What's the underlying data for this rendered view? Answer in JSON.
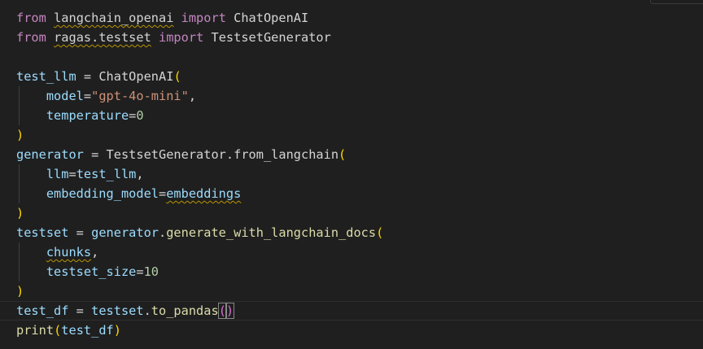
{
  "editor": {
    "lines": [
      [
        {
          "t": "from",
          "c": "kw"
        },
        {
          "t": " ",
          "c": "tx"
        },
        {
          "t": "langchain_openai",
          "c": "tx",
          "squig": true
        },
        {
          "t": " ",
          "c": "tx"
        },
        {
          "t": "import",
          "c": "kw"
        },
        {
          "t": " ChatOpenAI",
          "c": "tx"
        }
      ],
      [
        {
          "t": "from",
          "c": "kw"
        },
        {
          "t": " ",
          "c": "tx"
        },
        {
          "t": "ragas.testset",
          "c": "tx",
          "squig": true
        },
        {
          "t": " ",
          "c": "tx"
        },
        {
          "t": "import",
          "c": "kw"
        },
        {
          "t": " TestsetGenerator",
          "c": "tx"
        }
      ],
      [],
      [
        {
          "t": "test_llm",
          "c": "vr"
        },
        {
          "t": " = ",
          "c": "tx"
        },
        {
          "t": "ChatOpenAI",
          "c": "tx"
        },
        {
          "t": "(",
          "c": "p1"
        }
      ],
      [
        {
          "t": "    ",
          "c": "tx"
        },
        {
          "t": "model",
          "c": "vr"
        },
        {
          "t": "=",
          "c": "tx"
        },
        {
          "t": "\"gpt-4o-mini\"",
          "c": "st"
        },
        {
          "t": ",",
          "c": "tx"
        }
      ],
      [
        {
          "t": "    ",
          "c": "tx"
        },
        {
          "t": "temperature",
          "c": "vr"
        },
        {
          "t": "=",
          "c": "tx"
        },
        {
          "t": "0",
          "c": "nm"
        }
      ],
      [
        {
          "t": ")",
          "c": "p1"
        }
      ],
      [
        {
          "t": "generator",
          "c": "vr"
        },
        {
          "t": " = ",
          "c": "tx"
        },
        {
          "t": "TestsetGenerator",
          "c": "tx"
        },
        {
          "t": ".",
          "c": "tx"
        },
        {
          "t": "from_langchain",
          "c": "tx"
        },
        {
          "t": "(",
          "c": "p1"
        }
      ],
      [
        {
          "t": "    ",
          "c": "tx"
        },
        {
          "t": "llm",
          "c": "vr"
        },
        {
          "t": "=",
          "c": "tx"
        },
        {
          "t": "test_llm",
          "c": "vr"
        },
        {
          "t": ",",
          "c": "tx"
        }
      ],
      [
        {
          "t": "    ",
          "c": "tx"
        },
        {
          "t": "embedding_model",
          "c": "vr"
        },
        {
          "t": "=",
          "c": "tx"
        },
        {
          "t": "embeddings",
          "c": "vr",
          "squig": true
        }
      ],
      [
        {
          "t": ")",
          "c": "p1"
        }
      ],
      [
        {
          "t": "testset",
          "c": "vr"
        },
        {
          "t": " = ",
          "c": "tx"
        },
        {
          "t": "generator",
          "c": "vr"
        },
        {
          "t": ".",
          "c": "tx"
        },
        {
          "t": "generate_with_langchain_docs",
          "c": "fn"
        },
        {
          "t": "(",
          "c": "p1"
        }
      ],
      [
        {
          "t": "    ",
          "c": "tx"
        },
        {
          "t": "chunks",
          "c": "vr",
          "squig": true
        },
        {
          "t": ",",
          "c": "tx"
        }
      ],
      [
        {
          "t": "    ",
          "c": "tx"
        },
        {
          "t": "testset_size",
          "c": "vr"
        },
        {
          "t": "=",
          "c": "tx"
        },
        {
          "t": "10",
          "c": "nm"
        }
      ],
      [
        {
          "t": ")",
          "c": "p1"
        }
      ],
      [
        {
          "t": "test_df",
          "c": "vr"
        },
        {
          "t": " = ",
          "c": "tx"
        },
        {
          "t": "testset",
          "c": "vr"
        },
        {
          "t": ".",
          "c": "tx"
        },
        {
          "t": "to_pandas",
          "c": "fn"
        },
        {
          "t": "(",
          "c": "p2",
          "box": true
        },
        {
          "t": ")",
          "c": "p2",
          "box": true,
          "caret": true
        }
      ],
      [
        {
          "t": "print",
          "c": "fn"
        },
        {
          "t": "(",
          "c": "p1"
        },
        {
          "t": "test_df",
          "c": "vr"
        },
        {
          "t": ")",
          "c": "p1"
        }
      ]
    ]
  }
}
